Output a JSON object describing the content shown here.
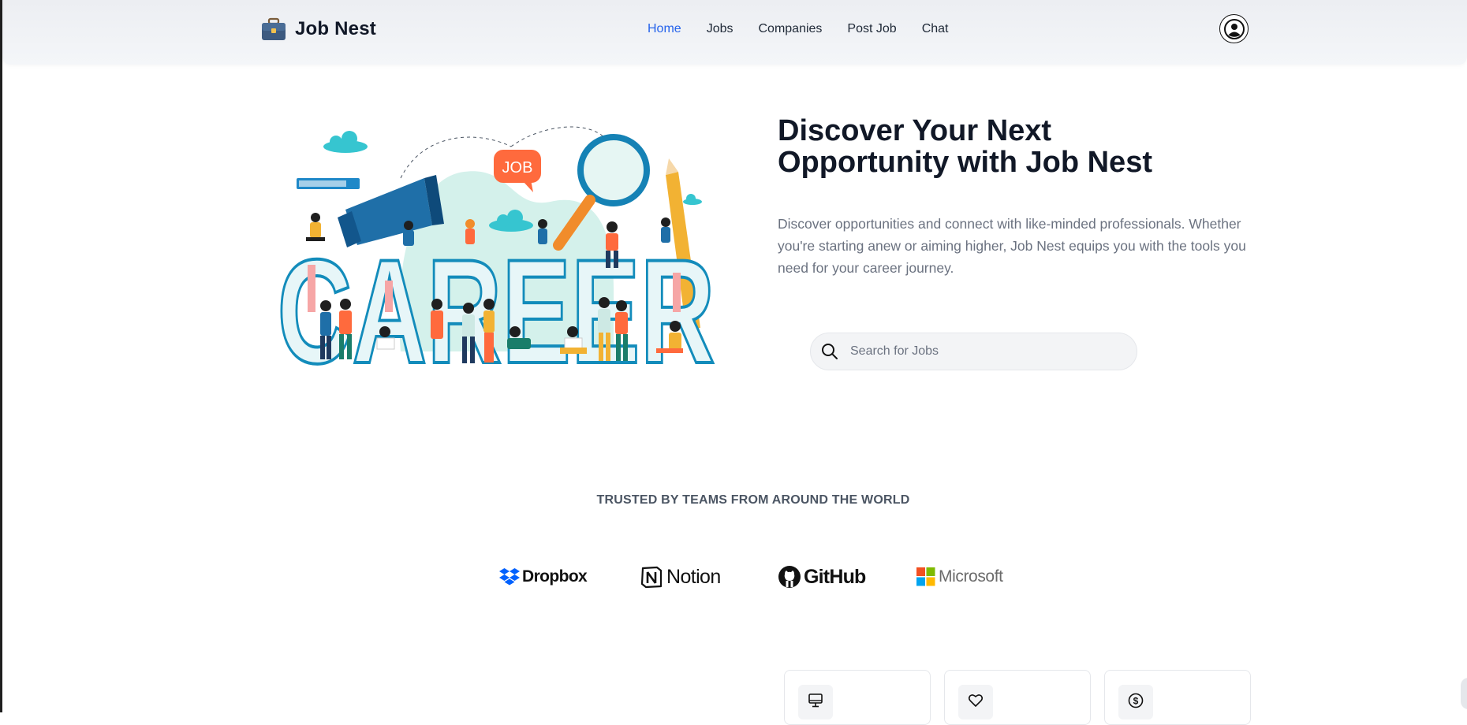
{
  "navbar": {
    "brand": {
      "name": "Job Nest",
      "icon": "briefcase-icon"
    },
    "links": [
      {
        "label": "Home",
        "active": true
      },
      {
        "label": "Jobs",
        "active": false
      },
      {
        "label": "Companies",
        "active": false
      },
      {
        "label": "Post Job",
        "active": false
      },
      {
        "label": "Chat",
        "active": false
      }
    ],
    "profile_icon": "user-circle-icon",
    "active_color": "#2563eb"
  },
  "hero": {
    "illustration_word": "CAREER",
    "illustration_bubble": "JOB",
    "title": "Discover Your Next Opportunity with Job Nest",
    "description": "Discover opportunities and connect with like-minded professionals. Whether you're starting anew or aiming higher, Job Nest equips you with the tools you need for your career journey.",
    "search": {
      "placeholder": "Search for Jobs",
      "value": "",
      "icon": "search-icon"
    }
  },
  "trusted": {
    "heading": "TRUSTED BY TEAMS FROM AROUND THE WORLD",
    "logos": [
      {
        "name": "Dropbox",
        "icon": "dropbox-icon"
      },
      {
        "name": "Notion",
        "icon": "notion-icon"
      },
      {
        "name": "GitHub",
        "icon": "github-icon"
      },
      {
        "name": "Microsoft",
        "icon": "microsoft-icon"
      }
    ]
  },
  "features": {
    "cards": [
      {
        "icon": "monitor-icon"
      },
      {
        "icon": "heart-icon"
      },
      {
        "icon": "dollar-circle-icon"
      }
    ]
  }
}
